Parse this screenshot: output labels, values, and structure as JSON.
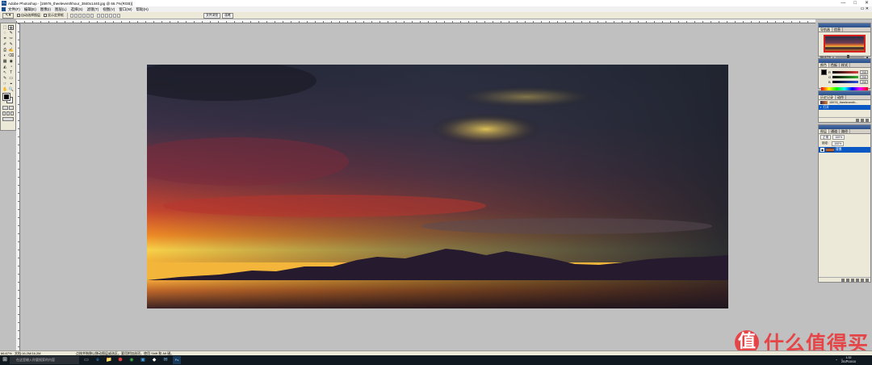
{
  "window": {
    "title": "Adobe Photoshop - [15976_theeleventhhour_3840x1440.jpg @ 66.7%(RGB)]",
    "controls": [
      "—",
      "□",
      "✕"
    ]
  },
  "menubar": {
    "items": [
      "文件(F)",
      "编辑(E)",
      "图像(I)",
      "图层(L)",
      "选择(S)",
      "滤镜(T)",
      "视图(V)",
      "窗口(W)",
      "帮助(H)"
    ]
  },
  "options": {
    "tool_preset": "↖▾",
    "auto_select_label": "自动选择图层",
    "show_bounds_label": "显示定界框",
    "palette_well": [
      "文件浏览",
      "画笔"
    ]
  },
  "toolbox": {
    "tools": [
      "⬚",
      "✥",
      "◌",
      "✎",
      "⌗",
      "✂",
      "✐",
      "✎",
      "⎙",
      "✍",
      "◐",
      "⌫",
      "▦",
      "◉",
      "◭",
      "◔",
      "↖",
      "T",
      "✎",
      "▭",
      "☞",
      "⌖",
      "✋",
      "🔍"
    ]
  },
  "navigator": {
    "tabs": [
      "导航器",
      "信息"
    ],
    "zoom_value": "66.67%"
  },
  "color": {
    "tabs": [
      "颜色",
      "色板",
      "样式"
    ],
    "rows": [
      {
        "channel": "R",
        "value": "255",
        "color": "#e04040"
      },
      {
        "channel": "G",
        "value": "255",
        "color": "#30b030"
      },
      {
        "channel": "B",
        "value": "255",
        "color": "#3050e0"
      }
    ]
  },
  "history": {
    "tabs": [
      "历史记录",
      "动作"
    ],
    "snapshot_label": "15976_theeleventh...",
    "items": [
      "打开"
    ]
  },
  "layers": {
    "tabs": [
      "图层",
      "通道",
      "路径"
    ],
    "blend_mode": "正常",
    "opacity": "100%",
    "lock_label": "锁定:",
    "fill": "100%",
    "layer_name": "背景"
  },
  "status": {
    "zoom": "66.67%",
    "doc_size": "文档:16.2M/16.2M",
    "hint": "点按并拖移以移动图层或选区。要用附加选项，使用 Shift 和 Alt 键。"
  },
  "taskbar": {
    "start_icon": "⊞",
    "search_placeholder": "在这里输入你要搜索的内容",
    "apps": [
      "▭",
      "e",
      "📁",
      "⬢",
      "◉",
      "▣",
      "◆",
      "✉",
      "Ps"
    ],
    "clock_time": "1:32",
    "clock_date": "2017/10/10"
  },
  "watermark": {
    "logo_char": "值",
    "text": "什么值得买"
  }
}
